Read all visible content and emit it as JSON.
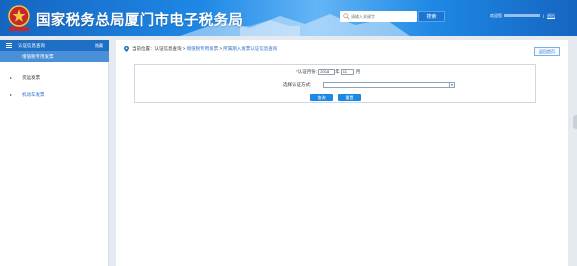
{
  "header": {
    "title": "国家税务总局厦门市电子税务局",
    "search_placeholder": "请输入关键字",
    "search_button": "搜索",
    "welcome_label": "欢迎您",
    "separator": "|",
    "logout": "退出"
  },
  "sidebar": {
    "section_title": "认证信息查询",
    "collapse_label": "隐藏",
    "active_item": "增值税专用发票",
    "items": [
      {
        "label": "货运发票"
      },
      {
        "label": "机动车发票"
      }
    ]
  },
  "breadcrumb": {
    "prefix": "当前位置：",
    "root": "认证信息查询",
    "sep1": " > ",
    "level2": "增值税专用发票",
    "sep2": " > ",
    "level3": "所属期入发票认证信息查询"
  },
  "back_button": "返回首页",
  "form": {
    "required_mark": "*",
    "period_label": "认证月份:",
    "year_value": "2018",
    "year_unit": "年",
    "month_value": "11",
    "month_unit": "月",
    "method_label": "选择认证方式:",
    "method_value": "",
    "query_button": "查询",
    "reset_button": "重置"
  },
  "colors": {
    "brand_blue": "#1e6fc6",
    "active_blue": "#4a90d9",
    "link_blue": "#2a6fc9",
    "button_blue": "#1e88e5"
  }
}
